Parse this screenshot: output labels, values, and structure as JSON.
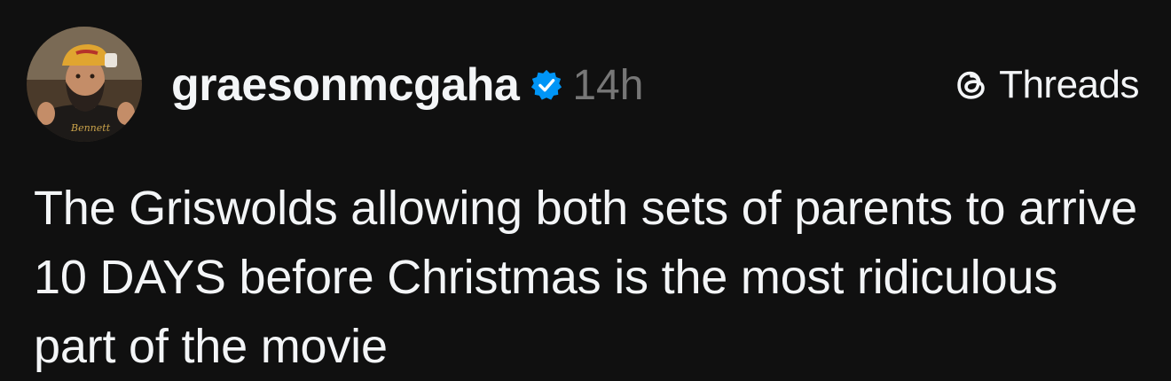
{
  "post": {
    "author": {
      "username": "graesonmcgaha",
      "verified_icon": "verified-badge-icon",
      "avatar_icon": "profile-photo"
    },
    "time": "14h",
    "brand": {
      "icon": "threads-logo-icon",
      "label": "Threads"
    },
    "text": "The Griswolds allowing both sets of parents to arrive 10 DAYS before Christmas is the most ridiculous part of the movie"
  },
  "colors": {
    "background": "#101010",
    "text": "#f3f5f7",
    "muted": "#777777",
    "verified": "#0095f6"
  }
}
